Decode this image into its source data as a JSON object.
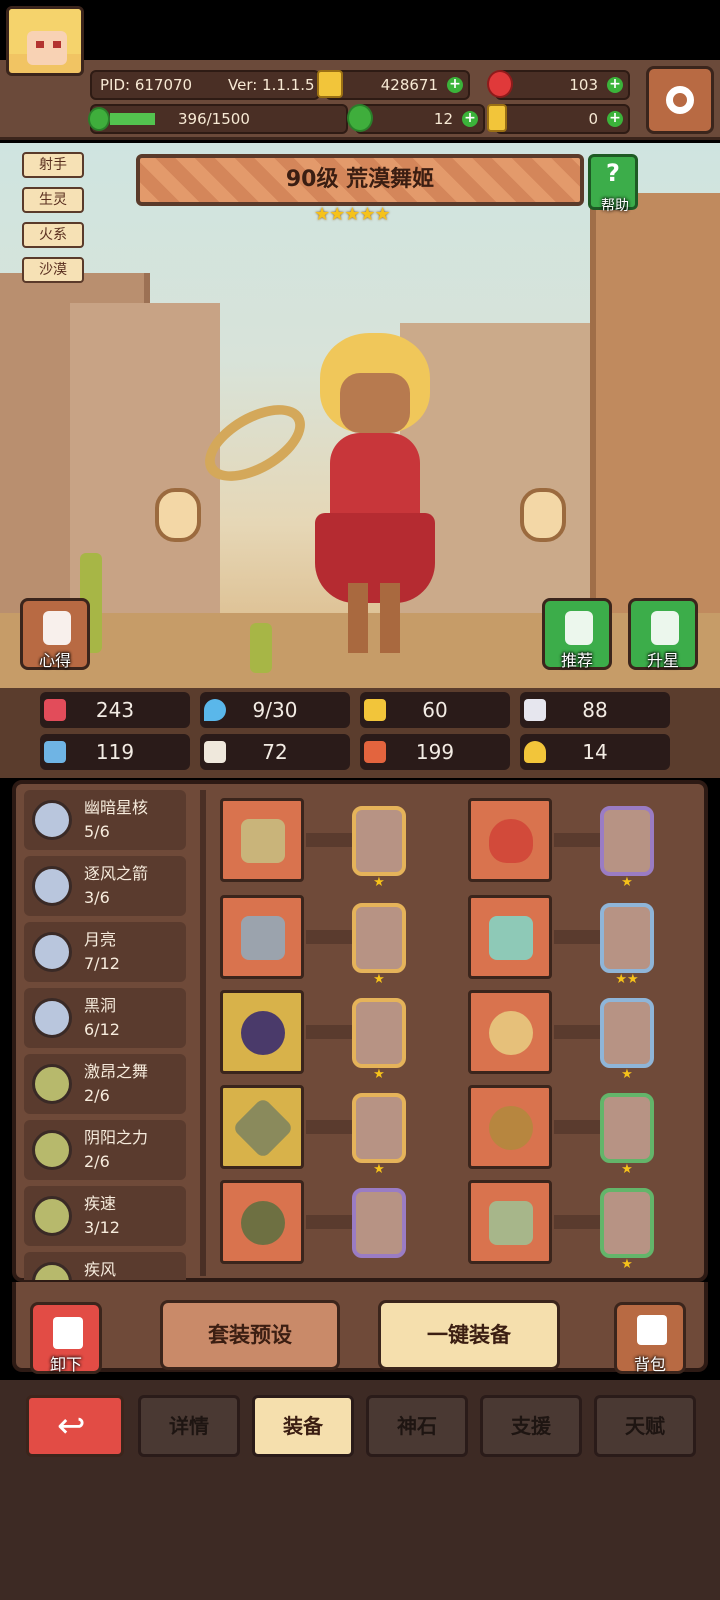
{
  "header": {
    "pid": "PID: 617070",
    "version": "Ver: 1.1.1.5",
    "xp": "396/1500",
    "xp_fraction": 0.264,
    "gold": "428671",
    "ruby": "103",
    "clover": "12",
    "keys": "0"
  },
  "hero": {
    "tags": [
      "射手",
      "生灵",
      "火系",
      "沙漠"
    ],
    "title": "90级  荒漠舞姬",
    "stars": "★★★★★",
    "help_label": "帮助",
    "tips_label": "心得",
    "recommend_label": "推荐",
    "starup_label": "升星"
  },
  "stats": [
    {
      "icon": "heart-icon",
      "value": "243"
    },
    {
      "icon": "water-drop-icon",
      "value": "9/30"
    },
    {
      "icon": "shield-icon",
      "value": "60"
    },
    {
      "icon": "wing-icon",
      "value": "88"
    },
    {
      "icon": "fist-icon",
      "value": "119"
    },
    {
      "icon": "book-icon",
      "value": "72"
    },
    {
      "icon": "boot-icon",
      "value": "199"
    },
    {
      "icon": "horseshoe-icon",
      "value": "14"
    }
  ],
  "sets": [
    {
      "name": "幽暗星核",
      "count": "5/6"
    },
    {
      "name": "逐风之箭",
      "count": "3/6"
    },
    {
      "name": "月亮",
      "count": "7/12"
    },
    {
      "name": "黑洞",
      "count": "6/12"
    },
    {
      "name": "激昂之舞",
      "count": "2/6"
    },
    {
      "name": "阴阳之力",
      "count": "2/6"
    },
    {
      "name": "疾速",
      "count": "3/12"
    },
    {
      "name": "疾风",
      "count": ""
    }
  ],
  "equipment": [
    {
      "slot": "bow",
      "card_stars": "★"
    },
    {
      "slot": "chest",
      "card_stars": "★"
    },
    {
      "slot": "arrow",
      "card_stars": "★"
    },
    {
      "slot": "armor",
      "card_stars": "★★"
    },
    {
      "slot": "necklace",
      "card_stars": "★"
    },
    {
      "slot": "ring-ornament",
      "card_stars": "★"
    },
    {
      "slot": "gem",
      "card_stars": "★"
    },
    {
      "slot": "ring",
      "card_stars": "★"
    },
    {
      "slot": "pot",
      "card_stars": ""
    },
    {
      "slot": "boots",
      "card_stars": "★"
    }
  ],
  "actions": {
    "unload_label": "卸下",
    "preset_label": "套装预设",
    "equip_all_label": "一键装备",
    "bag_label": "背包"
  },
  "tabs": [
    "详情",
    "装备",
    "神石",
    "支援",
    "天赋"
  ],
  "active_tab": "装备"
}
